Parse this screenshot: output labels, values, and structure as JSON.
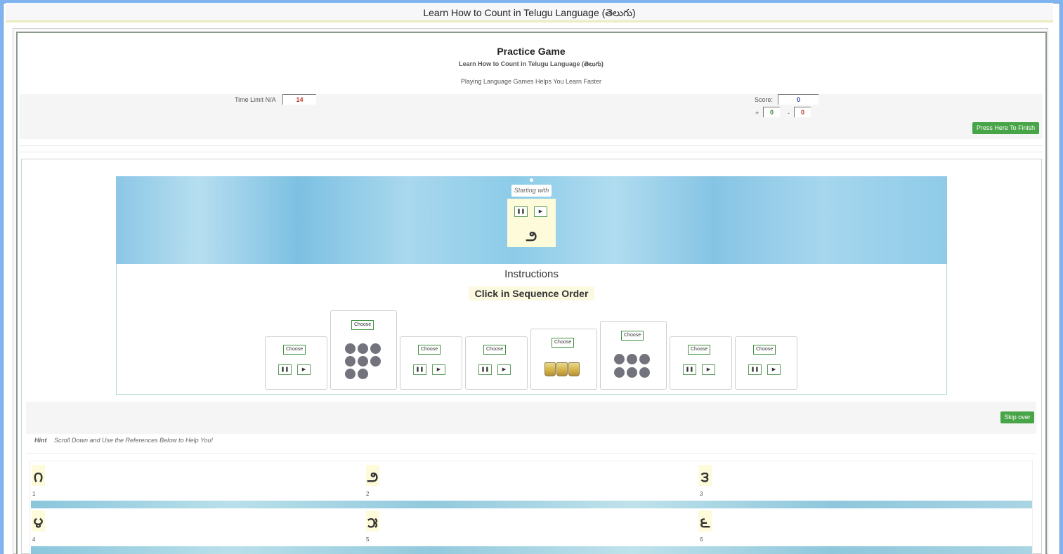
{
  "window": {
    "title": "Learn How to Count in Telugu Language (తెలుగు)"
  },
  "header": {
    "title": "Practice Game",
    "subtitle": "Learn How to Count in Telugu Language (తెలుగు)",
    "tagline": "Playing Language Games Helps You Learn Faster"
  },
  "stats": {
    "time_label": "Time Limit N/A",
    "time_value": "14",
    "score_label": "Score:",
    "score_value": "0",
    "plus_label": "+",
    "plus_value": "0",
    "minus_label": "-",
    "minus_value": "0",
    "finish_button": "Press Here To Finish"
  },
  "game": {
    "starting_label": "Starting with",
    "starting_digit": "౨",
    "instructions_title": "Instructions",
    "instructions_text": "Click in Sequence Order",
    "choose_label": "Choose",
    "pause_glyph": "❚❚",
    "play_glyph": "▶",
    "cards": [
      {
        "kind": "audio"
      },
      {
        "kind": "dots",
        "count": 8
      },
      {
        "kind": "audio"
      },
      {
        "kind": "audio"
      },
      {
        "kind": "cups",
        "count": 3
      },
      {
        "kind": "dots",
        "count": 6
      },
      {
        "kind": "audio"
      },
      {
        "kind": "audio"
      }
    ],
    "skip_button": "Skip over"
  },
  "hint": {
    "label": "Hint",
    "text": "Scroll Down and Use the References Below to Help You!"
  },
  "references": [
    {
      "digit": "౧",
      "number": "1"
    },
    {
      "digit": "౨",
      "number": "2"
    },
    {
      "digit": "౩",
      "number": "3"
    },
    {
      "digit": "౪",
      "number": "4"
    },
    {
      "digit": "౫",
      "number": "5"
    },
    {
      "digit": "౬",
      "number": "6"
    }
  ]
}
